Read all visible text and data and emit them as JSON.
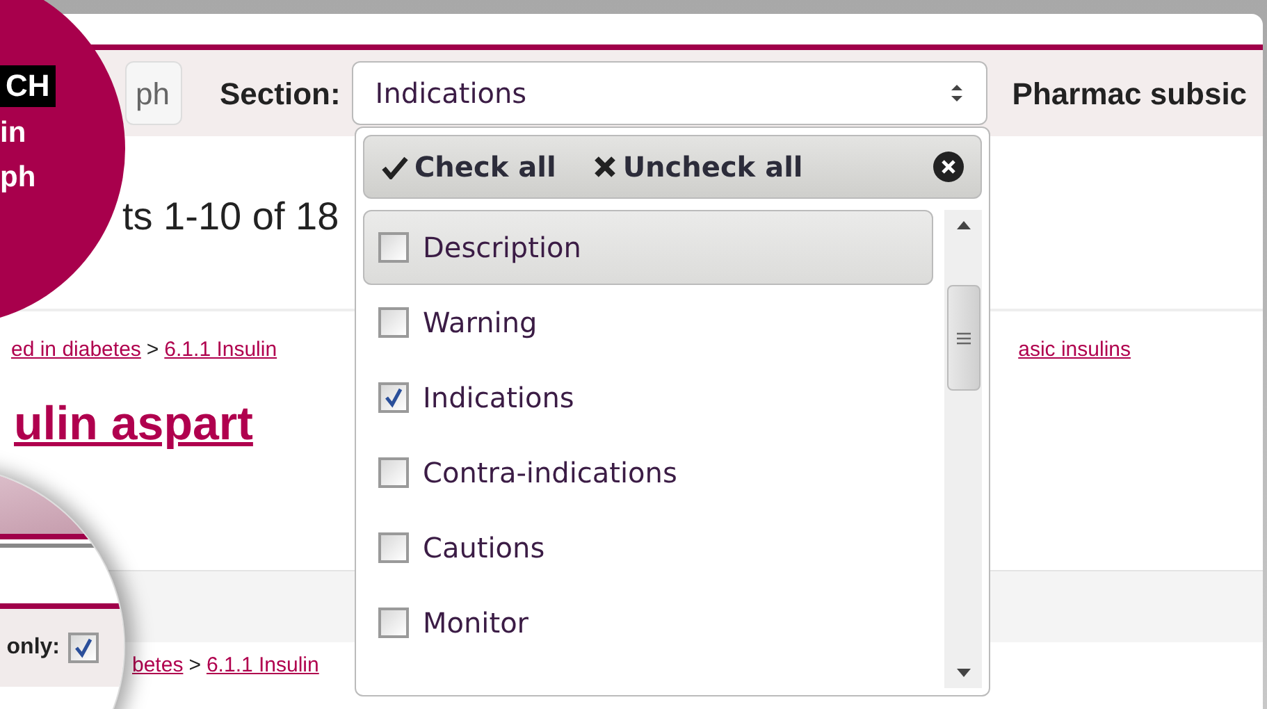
{
  "promo": {
    "badge": "CH",
    "lines": [
      "in",
      "ph"
    ]
  },
  "toolbar": {
    "button": "ph",
    "section_label": "Section:",
    "section_select": {
      "value": "Indications"
    },
    "pharmac_label": "Pharmac subsic"
  },
  "results": "ts 1-10 of 18",
  "breadcrumb": [
    {
      "kind": "link",
      "text": "ed in diabetes"
    },
    {
      "kind": "sep",
      "text": ">"
    },
    {
      "kind": "link",
      "text": "6.1.1 Insulin"
    }
  ],
  "breadcrumb_tail": "asic insulins",
  "title": "ulin aspart",
  "magnifier": {
    "label": "only:",
    "checked": true
  },
  "bottom_breadcrumb": [
    {
      "kind": "link",
      "text": "betes"
    },
    {
      "kind": "sep",
      "text": ">"
    },
    {
      "kind": "link",
      "text": "6.1.1 Insulin"
    }
  ],
  "dropdown": {
    "actions": [
      {
        "kind": "check",
        "label": "Check all"
      },
      {
        "kind": "uncheck",
        "label": "Uncheck all"
      }
    ],
    "items": [
      {
        "label": "Description",
        "checked": false,
        "selected": true
      },
      {
        "label": "Warning",
        "checked": false,
        "selected": false
      },
      {
        "label": "Indications",
        "checked": true,
        "selected": false
      },
      {
        "label": "Contra-indications",
        "checked": false,
        "selected": false
      },
      {
        "label": "Cautions",
        "checked": false,
        "selected": false
      },
      {
        "label": "Monitor",
        "checked": false,
        "selected": false
      }
    ]
  }
}
